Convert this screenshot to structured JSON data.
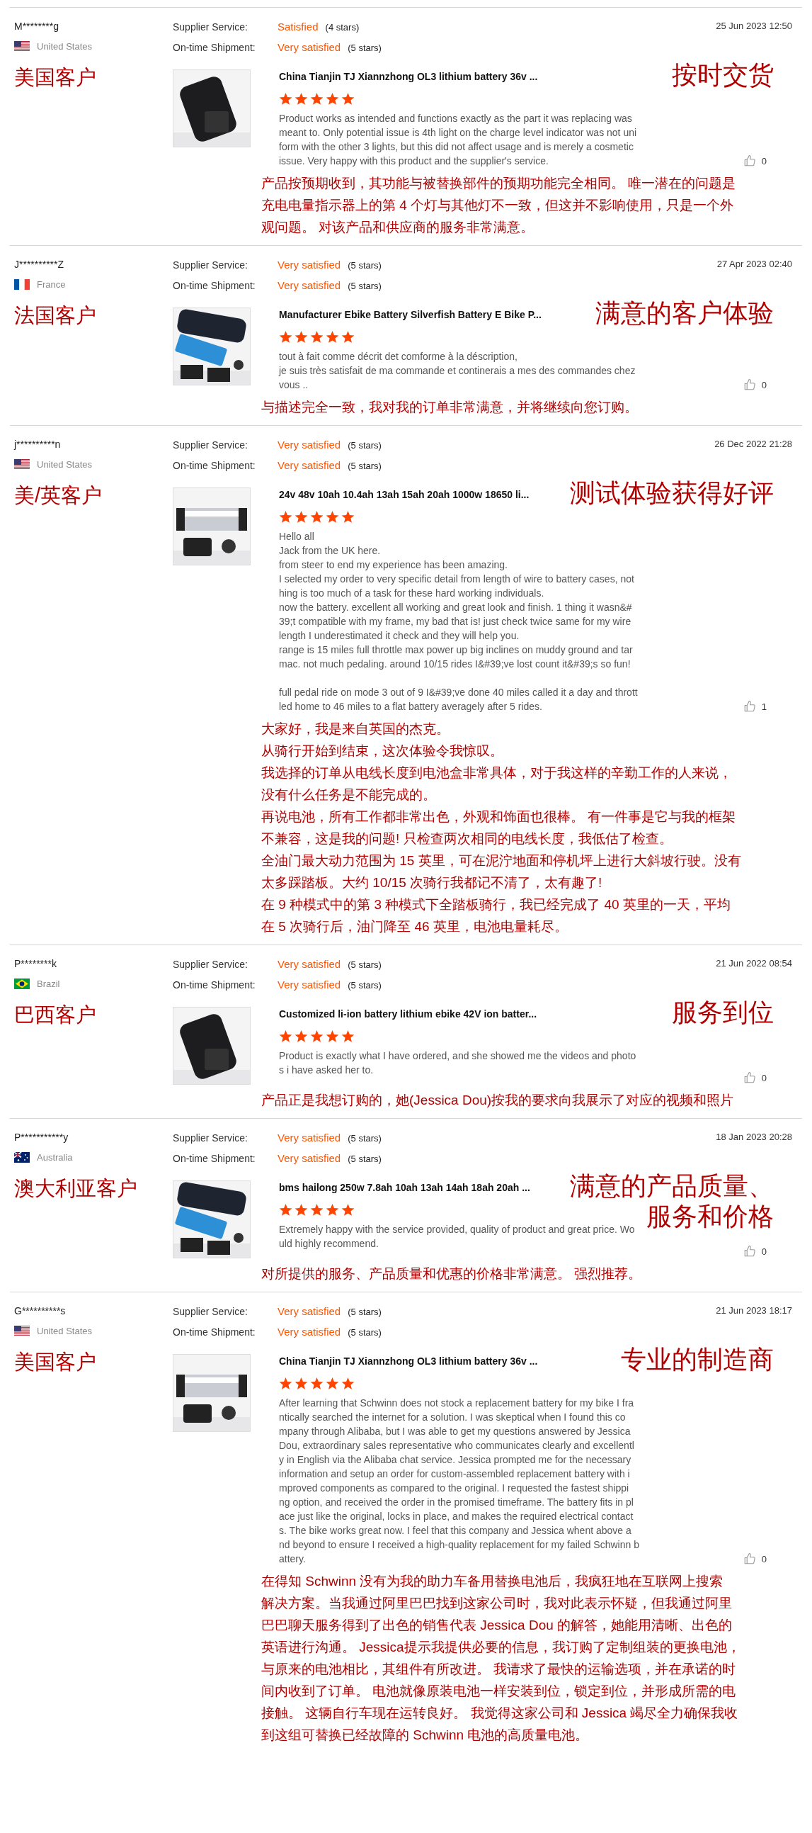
{
  "reviews": [
    {
      "buyer": "M********g",
      "country": "United States",
      "flag": {
        "kind": "us"
      },
      "region_label": "美国客户",
      "supplier_service": {
        "label": "Supplier Service:",
        "rating": "Satisfied",
        "stars_text": "(4 stars)"
      },
      "shipment": {
        "label": "On-time Shipment:",
        "rating": "Very satisfied",
        "stars_text": "(5 stars)"
      },
      "date": "25 Jun 2023 12:50",
      "headline": [
        "按时交货"
      ],
      "product": {
        "title": "China Tianjin TJ Xiannzhong OL3 lithium battery 36v ..."
      },
      "stars": 5,
      "text": [
        [
          "Product works as intended and functions exactly as the part it was replacing was",
          "meant to. Only potential issue is 4th light on the charge level indicator was not uni",
          "form with the other 3 lights, but this did not affect usage and is merely a cosmetic",
          "issue. Very happy with this product and the supplier's service."
        ]
      ],
      "likes": "0",
      "translation": [
        "产品按预期收到，其功能与被替换部件的预期功能完全相同。 唯一潜在的问题是",
        "充电电量指示器上的第 4 个灯与其他灯不一致，但这并不影响使用，只是一个外",
        "观问题。 对该产品和供应商的服务非常满意。"
      ]
    },
    {
      "buyer": "J**********Z",
      "country": "France",
      "flag": {
        "kind": "fr"
      },
      "region_label": "法国客户",
      "supplier_service": {
        "label": "Supplier Service:",
        "rating": "Very satisfied",
        "stars_text": "(5 stars)"
      },
      "shipment": {
        "label": "On-time Shipment:",
        "rating": "Very satisfied",
        "stars_text": "(5 stars)"
      },
      "date": "27 Apr 2023 02:40",
      "headline": [
        "满意的客户体验"
      ],
      "product": {
        "title": "Manufacturer Ebike Battery Silverfish Battery E Bike P..."
      },
      "stars": 5,
      "text": [
        [
          "tout à fait comme décrit det comforme à la déscription,",
          "je suis très satisfait de ma commande et continerais a mes des commandes chez",
          "vous .."
        ]
      ],
      "likes": "0",
      "translation": [
        "与描述完全一致，我对我的订单非常满意，并将继续向您订购。"
      ]
    },
    {
      "buyer": "j**********n",
      "country": "United States",
      "flag": {
        "kind": "us"
      },
      "region_label": "美/英客户",
      "supplier_service": {
        "label": "Supplier Service:",
        "rating": "Very satisfied",
        "stars_text": "(5 stars)"
      },
      "shipment": {
        "label": "On-time Shipment:",
        "rating": "Very satisfied",
        "stars_text": "(5 stars)"
      },
      "date": "26 Dec 2022 21:28",
      "headline": [
        "测试体验获得好评"
      ],
      "product": {
        "title": "24v 48v 10ah 10.4ah 13ah 15ah 20ah 1000w 18650 li..."
      },
      "stars": 5,
      "text": [
        [
          "Hello all",
          "Jack from the UK here.",
          "from steer to end my experience has been amazing.",
          "I selected my order to very specific detail from length of wire to battery cases, not",
          "hing is too much of a task for these hard working individuals.",
          "now the battery. excellent all working and great look and finish. 1 thing it wasn&#",
          "39;t compatible with my frame, my bad that is! just check twice same for my wire",
          "length I underestimated it check and they will help you.",
          "range is 15 miles full throttle max power up big inclines on muddy ground and tar",
          "mac. not much pedaling. around 10/15 rides I&#39;ve lost count it&#39;s so fun!"
        ],
        [
          "full pedal ride on mode 3 out of 9 I&#39;ve done 40 miles called it a day and thrott",
          "led home to 46 miles to a flat battery averagely after 5 rides."
        ]
      ],
      "likes": "1",
      "translation": [
        "大家好，我是来自英国的杰克。",
        "从骑行开始到结束，这次体验令我惊叹。",
        "我选择的订单从电线长度到电池盒非常具体，对于我这样的辛勤工作的人来说，",
        "没有什么任务是不能完成的。",
        "再说电池，所有工作都非常出色，外观和饰面也很棒。 有一件事是它与我的框架",
        "不兼容，这是我的问题! 只检查两次相同的电线长度，我低估了检查。",
        "全油门最大动力范围为 15 英里，可在泥泞地面和停机坪上进行大斜坡行驶。没有",
        "太多踩踏板。大约 10/15 次骑行我都记不清了，太有趣了!",
        "在 9 种模式中的第 3 种模式下全踏板骑行，我已经完成了 40 英里的一天，平均",
        "在 5 次骑行后，油门降至 46 英里，电池电量耗尽。"
      ]
    },
    {
      "buyer": "P********k",
      "country": "Brazil",
      "flag": {
        "kind": "br"
      },
      "region_label": "巴西客户",
      "supplier_service": {
        "label": "Supplier Service:",
        "rating": "Very satisfied",
        "stars_text": "(5 stars)"
      },
      "shipment": {
        "label": "On-time Shipment:",
        "rating": "Very satisfied",
        "stars_text": "(5 stars)"
      },
      "date": "21 Jun 2022 08:54",
      "headline": [
        "服务到位"
      ],
      "product": {
        "title": "Customized li-ion battery lithium ebike 42V ion batter..."
      },
      "stars": 5,
      "text": [
        [
          "Product is exactly what I have ordered, and she showed me the videos and photo",
          "s i have asked her to."
        ]
      ],
      "likes": "0",
      "translation": [
        "产品正是我想订购的，她(Jessica Dou)按我的要求向我展示了对应的视频和照片"
      ]
    },
    {
      "buyer": "P***********y",
      "country": "Australia",
      "flag": {
        "kind": "au"
      },
      "region_label": "澳大利亚客户",
      "supplier_service": {
        "label": "Supplier Service:",
        "rating": "Very satisfied",
        "stars_text": "(5 stars)"
      },
      "shipment": {
        "label": "On-time Shipment:",
        "rating": "Very satisfied",
        "stars_text": "(5 stars)"
      },
      "date": "18 Jan 2023 20:28",
      "headline": [
        "满意的产品质量、",
        "服务和价格"
      ],
      "product": {
        "title": "bms hailong 250w 7.8ah 10ah 13ah 14ah 18ah 20ah ..."
      },
      "stars": 5,
      "text": [
        [
          "Extremely happy with the service provided, quality of product and great price. Wo",
          "uld highly recommend."
        ]
      ],
      "likes": "0",
      "translation": [
        "对所提供的服务、产品质量和优惠的价格非常满意。 强烈推荐。"
      ]
    },
    {
      "buyer": "G**********s",
      "country": "United States",
      "flag": {
        "kind": "us"
      },
      "region_label": "美国客户",
      "supplier_service": {
        "label": "Supplier Service:",
        "rating": "Very satisfied",
        "stars_text": "(5 stars)"
      },
      "shipment": {
        "label": "On-time Shipment:",
        "rating": "Very satisfied",
        "stars_text": "(5 stars)"
      },
      "date": "21 Jun 2023 18:17",
      "headline": [
        "专业的制造商"
      ],
      "product": {
        "title": "China Tianjin TJ Xiannzhong OL3 lithium battery 36v ..."
      },
      "stars": 5,
      "text": [
        [
          "After learning that Schwinn does not stock a replacement battery for my bike I fra",
          "ntically searched the internet for a solution.  I was skeptical when I found this co",
          "mpany through Alibaba, but I was able to get my questions answered by Jessica",
          "Dou, extraordinary sales representative who communicates clearly and excellentl",
          "y in English via the Alibaba chat service.  Jessica prompted me for the necessary",
          "information and setup an order for custom-assembled replacement battery with i",
          "mproved components as compared to the original.  I requested the fastest shippi",
          "ng option, and received the order in the promised timeframe.  The battery fits in pl",
          "ace just like the original, locks in place, and makes the required electrical contact",
          "s.  The bike works great now.  I feel that this company and Jessica whent above a",
          "nd beyond to ensure I received a high-quality replacement for my failed Schwinn b",
          "attery."
        ]
      ],
      "likes": "0",
      "translation": [
        "在得知 Schwinn 没有为我的助力车备用替换电池后，我疯狂地在互联网上搜索",
        "解决方案。当我通过阿里巴巴找到这家公司时，我对此表示怀疑，但我通过阿里",
        "巴巴聊天服务得到了出色的销售代表 Jessica Dou 的解答，她能用清晰、出色的",
        "英语进行沟通。 Jessica提示我提供必要的信息，我订购了定制组装的更换电池，",
        "与原来的电池相比，其组件有所改进。 我请求了最快的运输选项，并在承诺的时",
        "间内收到了订单。 电池就像原装电池一样安装到位，锁定到位，并形成所需的电",
        "接触。 这辆自行车现在运转良好。 我觉得这家公司和 Jessica 竭尽全力确保我收",
        "到这组可替换已经故障的 Schwinn 电池的高质量电池。"
      ]
    }
  ]
}
